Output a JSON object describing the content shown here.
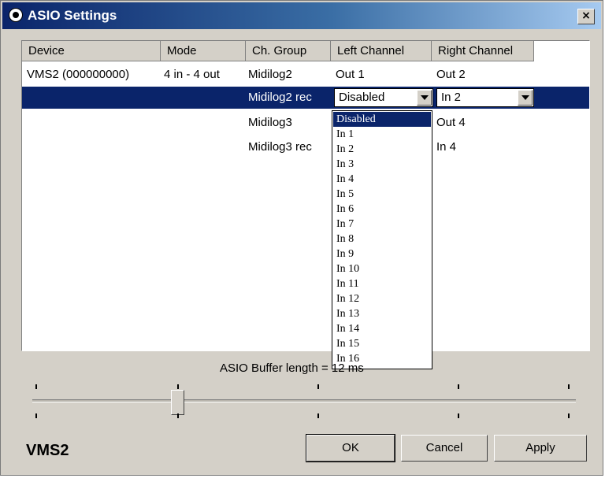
{
  "window": {
    "title": "ASIO Settings",
    "close_glyph": "×"
  },
  "columns": [
    "Device",
    "Mode",
    "Ch. Group",
    "Left Channel",
    "Right Channel"
  ],
  "rows": [
    {
      "device": "VMS2 (000000000)",
      "mode": "4 in - 4 out",
      "group": "Midilog2",
      "left": "Out 1",
      "right": "Out 2"
    },
    {
      "device": "",
      "mode": "",
      "group": "Midilog2 rec",
      "left": "Disabled",
      "right": "In 2"
    },
    {
      "device": "",
      "mode": "",
      "group": "Midilog3",
      "left": "",
      "right": "Out 4"
    },
    {
      "device": "",
      "mode": "",
      "group": "Midilog3 rec",
      "left": "",
      "right": "In 4"
    }
  ],
  "dropdown_options": [
    "Disabled",
    "In 1",
    "In 2",
    "In 3",
    "In 4",
    "In 5",
    "In 6",
    "In 7",
    "In 8",
    "In 9",
    "In 10",
    "In 11",
    "In 12",
    "In 13",
    "In 14",
    "In 15",
    "In 16"
  ],
  "dropdown_selected": "Disabled",
  "buffer": {
    "label": "ASIO Buffer length",
    "value_text": "= 12 ms"
  },
  "footer": {
    "brand": "VMS2",
    "ok": "OK",
    "cancel": "Cancel",
    "apply": "Apply"
  },
  "colors": {
    "selection": "#0a246a",
    "face": "#d4d0c8"
  },
  "icons": {
    "title": "asio-app-icon",
    "close": "close-icon",
    "dropdown": "chevron-down-icon"
  }
}
